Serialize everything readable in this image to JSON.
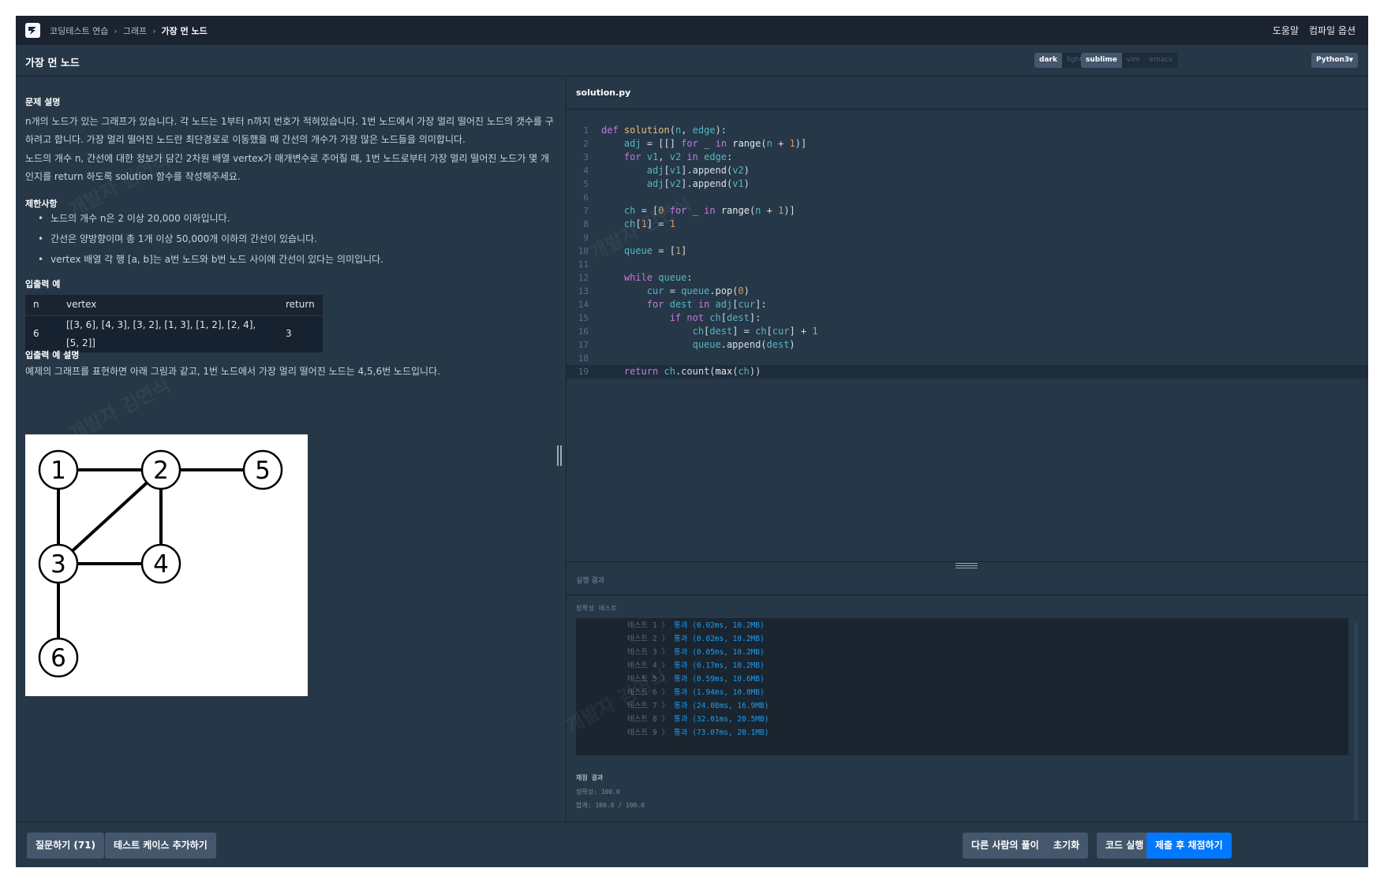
{
  "nav": {
    "breadcrumb": [
      "코딩테스트 연습",
      "그래프",
      "가장 먼 노드"
    ],
    "sep": "›",
    "help": "도움말",
    "compile_options": "컴파일 옵션"
  },
  "title": "가장 먼 노드",
  "theme": {
    "dark": "dark",
    "light": "light"
  },
  "keymap": {
    "sublime": "sublime",
    "vim": "vim",
    "emacs": "emacs"
  },
  "language": "Python3",
  "desc": {
    "h_problem": "문제 설명",
    "p1": "n개의 노드가 있는 그래프가 있습니다. 각 노드는 1부터 n까지 번호가 적혀있습니다. 1번 노드에서 가장 멀리 떨어진 노드의 갯수를 구하려고 합니다. 가장 멀리 떨어진 노드란 최단경로로 이동했을 때 간선의 개수가 가장 많은 노드들을 의미합니다.",
    "p2": "노드의 개수 n, 간선에 대한 정보가 담긴 2차원 배열 vertex가 매개변수로 주어질 때, 1번 노드로부터 가장 멀리 떨어진 노드가 몇 개인지를 return 하도록 solution 함수를 작성해주세요.",
    "h_constraints": "제한사항",
    "constraints": [
      "노드의 개수 n은 2 이상 20,000 이하입니다.",
      "간선은 양방향이며 총 1개 이상 50,000개 이하의 간선이 있습니다.",
      "vertex 배열 각 행 [a, b]는 a번 노드와 b번 노드 사이에 간선이 있다는 의미입니다."
    ],
    "h_io": "입출력 예",
    "table": {
      "headers": [
        "n",
        "vertex",
        "return"
      ],
      "rows": [
        [
          "6",
          "[[3, 6], [4, 3], [3, 2], [1, 3], [1, 2], [2, 4], [5, 2]]",
          "3"
        ]
      ]
    },
    "h_io_desc": "입출력 예 설명",
    "p3": "예제의 그래프를 표현하면 아래 그림과 같고, 1번 노드에서 가장 멀리 떨어진 노드는 4,5,6번 노드입니다.",
    "graph_nodes": [
      "1",
      "2",
      "3",
      "4",
      "5",
      "6"
    ]
  },
  "editor": {
    "filename": "solution.py",
    "line_numbers": [
      "1",
      "2",
      "3",
      "4",
      "5",
      "6",
      "7",
      "8",
      "9",
      "10",
      "11",
      "12",
      "13",
      "14",
      "15",
      "16",
      "17",
      "18",
      "19"
    ]
  },
  "console": {
    "title": "실행 결과",
    "label": "정확성  테스트",
    "tests": [
      {
        "name": "테스트 1 〉",
        "result": "통과 (0.02ms, 10.2MB)"
      },
      {
        "name": "테스트 2 〉",
        "result": "통과 (0.02ms, 10.2MB)"
      },
      {
        "name": "테스트 3 〉",
        "result": "통과 (0.05ms, 10.2MB)"
      },
      {
        "name": "테스트 4 〉",
        "result": "통과 (0.17ms, 10.2MB)"
      },
      {
        "name": "테스트 5 〉",
        "result": "통과 (0.59ms, 10.6MB)"
      },
      {
        "name": "테스트 6 〉",
        "result": "통과 (1.94ms, 10.8MB)"
      },
      {
        "name": "테스트 7 〉",
        "result": "통과 (24.08ms, 16.9MB)"
      },
      {
        "name": "테스트 8 〉",
        "result": "통과 (32.01ms, 20.5MB)"
      },
      {
        "name": "테스트 9 〉",
        "result": "통과 (73.07ms, 20.1MB)"
      }
    ],
    "grade_head": "채점 결과",
    "accuracy": "정확성: 100.0",
    "total": "합계: 100.0 / 100.0"
  },
  "footer": {
    "ask": "질문하기 (71)",
    "add_test": "테스트 케이스 추가하기",
    "others": "다른 사람의 풀이",
    "reset": "초기화",
    "run": "코드 실행",
    "submit": "제출 후 채점하기"
  },
  "watermark": "개발자 김연식",
  "colors": {
    "bg": "#263747",
    "nav": "#1b2330",
    "accent": "#0078ff",
    "pass": "#1d9bf0"
  }
}
